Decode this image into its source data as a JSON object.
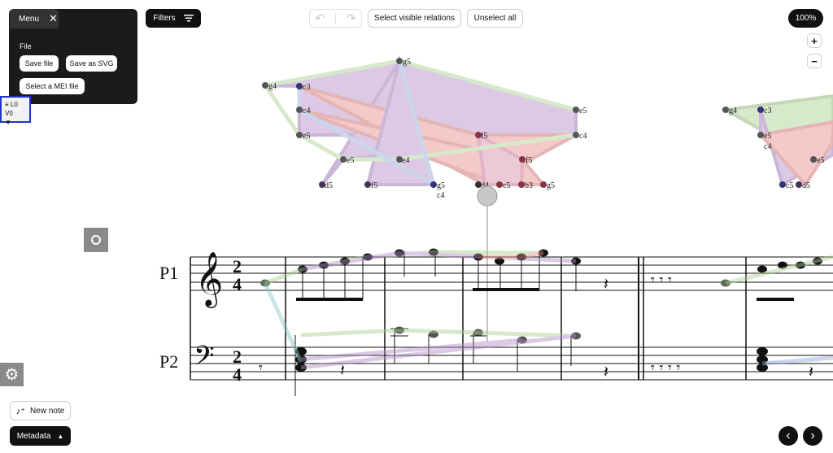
{
  "menu": {
    "title": "Menu",
    "section_file": "File",
    "save_file": "Save file",
    "save_svg": "Save as SVG",
    "select_mei": "Select a MEI file"
  },
  "toolbar": {
    "filters": "Filters",
    "select_visible": "Select visible relations",
    "unselect_all": "Unselect all",
    "zoom": "100%",
    "zoom_in": "+",
    "zoom_out": "−"
  },
  "level_selector": {
    "label": "≡ L0 V0",
    "arrow": "▼"
  },
  "score": {
    "part1": "P1",
    "part2": "P2",
    "time_sig_top": "2",
    "time_sig_bottom": "4"
  },
  "note_labels": [
    "g5",
    "g4",
    "c3",
    "c4",
    "e5",
    "e5",
    "c5",
    "d5",
    "f5",
    "e4",
    "g5",
    "c4",
    "f5",
    "f5",
    "d4",
    "c5",
    "b3",
    "g5",
    "e5",
    "c4",
    "g4",
    "c3",
    "e5",
    "c4",
    "c5",
    "d5",
    "e5"
  ],
  "bottom": {
    "new_note": "New note",
    "metadata": "Metadata",
    "prev": "‹",
    "next": "›"
  },
  "icons": {
    "close": "close-icon",
    "filter": "filter-lines-icon",
    "undo": "undo-icon",
    "redo": "redo-icon",
    "gear": "gear-icon",
    "record": "circle-icon",
    "new_note": "note-plus-icon",
    "caret_up": "caret-up-icon"
  },
  "colors": {
    "relation_green": "#a8d08d",
    "relation_purple": "#b38cc6",
    "relation_red": "#e88a8a",
    "relation_blue": "#8ea3d6",
    "node_grey": "#6b6b6b",
    "selection_border": "#2233cc"
  }
}
